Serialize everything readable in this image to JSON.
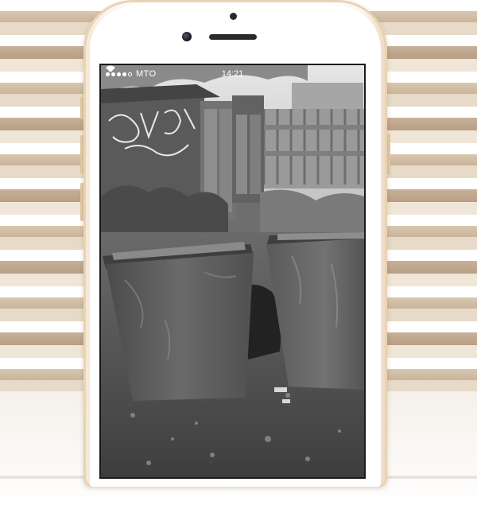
{
  "status_bar": {
    "carrier": "MTO",
    "time": "14:21",
    "signal_bars": 4
  },
  "screen": {
    "content": "grayscale-photo",
    "colors": {
      "sky": "#d8d8d8",
      "wall": "#5a5a5a",
      "ground": "#4c4c4c",
      "bin": "#5b5b5b"
    }
  },
  "device": {
    "color": "gold",
    "accent": "#e3c9a6"
  }
}
